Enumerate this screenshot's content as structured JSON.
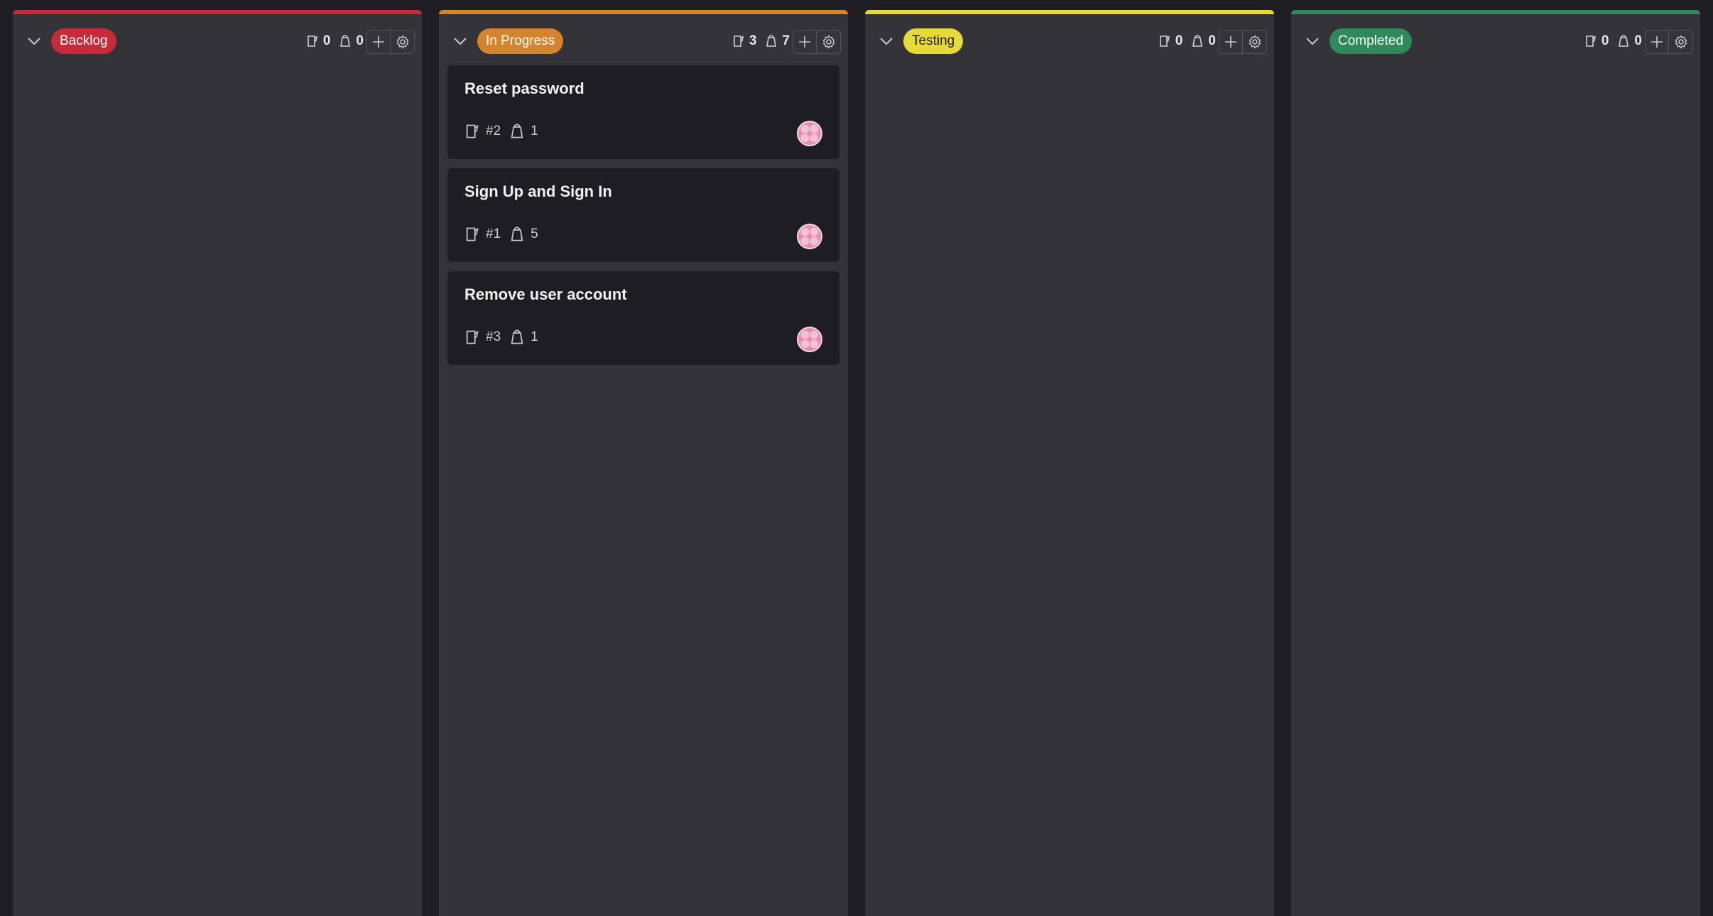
{
  "colors": {
    "backlog": "#c62a3b",
    "in_progress": "#d4842e",
    "testing": "#e6d93c",
    "completed": "#2e8a5a"
  },
  "columns": [
    {
      "name": "Backlog",
      "accent": "#c62a3b",
      "badge_text_color": "#ffffff",
      "stories": "0",
      "points": "0",
      "cards": []
    },
    {
      "name": "In Progress",
      "accent": "#d4842e",
      "badge_text_color": "#ffffff",
      "stories": "3",
      "points": "7",
      "cards": [
        {
          "title": "Reset password",
          "id": "#2",
          "points": "1",
          "avatar": "user-avatar"
        },
        {
          "title": "Sign Up and Sign In",
          "id": "#1",
          "points": "5",
          "avatar": "user-avatar"
        },
        {
          "title": "Remove user account",
          "id": "#3",
          "points": "1",
          "avatar": "user-avatar"
        }
      ]
    },
    {
      "name": "Testing",
      "accent": "#e6d93c",
      "badge_text_color": "#1e1e22",
      "stories": "0",
      "points": "0",
      "cards": []
    },
    {
      "name": "Completed",
      "accent": "#2e8a5a",
      "badge_text_color": "#ffffff",
      "stories": "0",
      "points": "0",
      "cards": []
    }
  ],
  "icons": {
    "collapse": "chevron-down-icon",
    "stories": "story-icon",
    "points": "weight-icon",
    "add": "plus-icon",
    "settings": "gear-icon"
  }
}
